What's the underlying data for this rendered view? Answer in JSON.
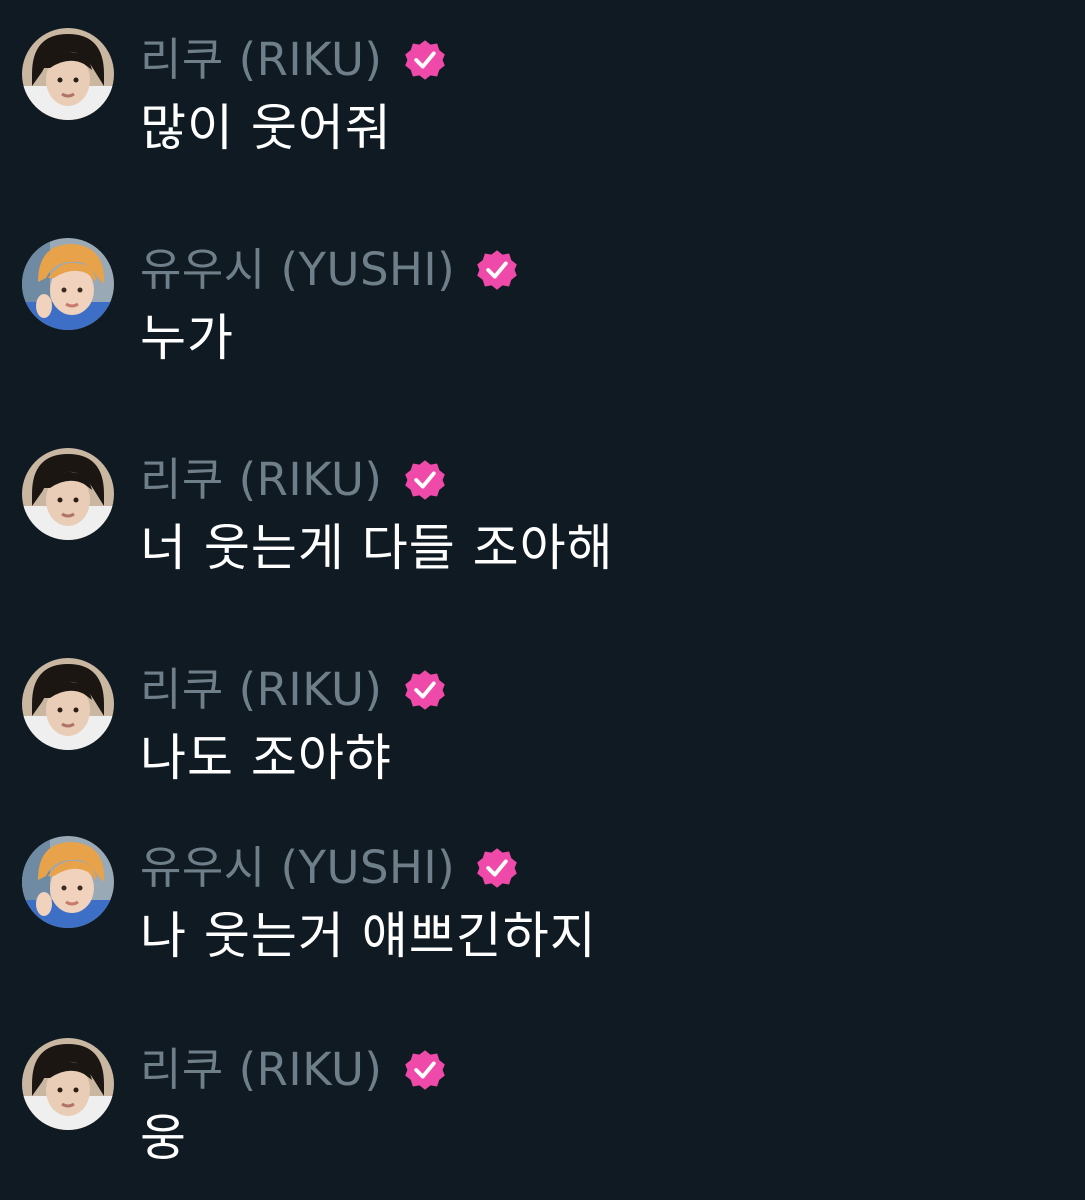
{
  "messages": [
    {
      "author": "riku",
      "name": "리쿠 (RIKU)",
      "text": "많이 웃어줘"
    },
    {
      "author": "yushi",
      "name": "유우시 (YUSHI)",
      "text": "누가"
    },
    {
      "author": "riku",
      "name": "리쿠 (RIKU)",
      "text": "너 웃는게 다들 조아해"
    },
    {
      "author": "riku",
      "name": "리쿠 (RIKU)",
      "text": "나도 조아햐"
    },
    {
      "author": "yushi",
      "name": "유우시 (YUSHI)",
      "text": "나 웃는거 얘쁘긴하지"
    },
    {
      "author": "riku",
      "name": "리쿠 (RIKU)",
      "text": "웅"
    }
  ],
  "colors": {
    "background": "#0f1a22",
    "name": "#6f7f89",
    "text": "#ffffff",
    "verified_badge": "#ef4aa9"
  },
  "icons": {
    "verified": "verified-badge-icon"
  }
}
